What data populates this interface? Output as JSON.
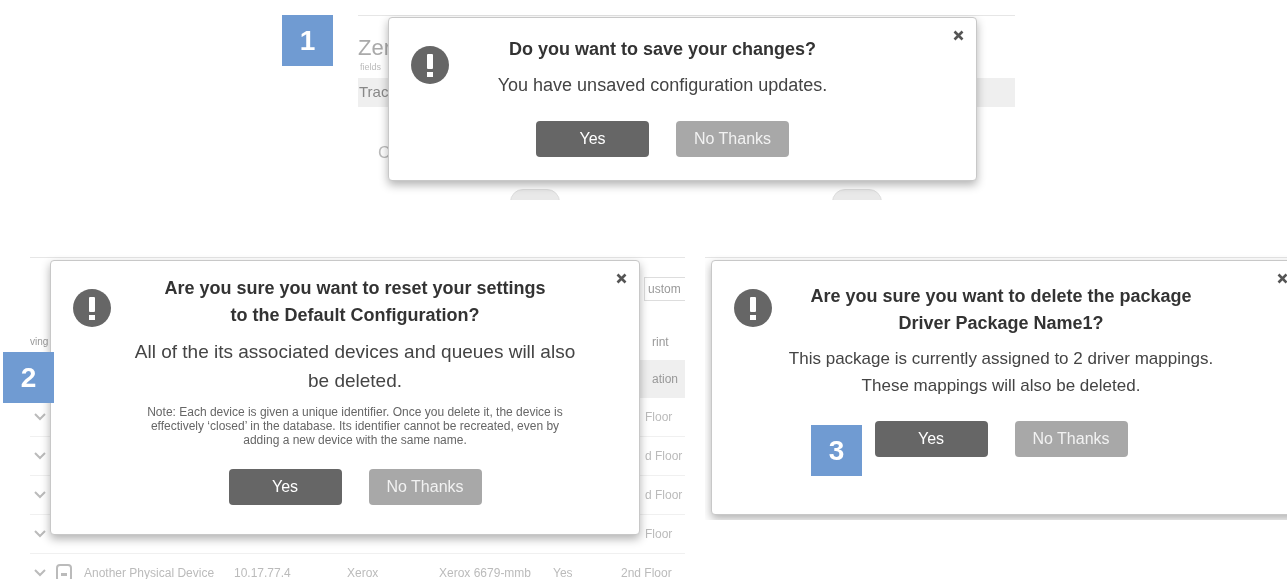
{
  "examples": [
    {
      "number": "1",
      "background": {
        "kind": "settings",
        "heading": "Zer",
        "caption": "fields",
        "bar": "Trac",
        "label": "C",
        "toggles": [
          {
            "on": false
          },
          {
            "on": false
          }
        ]
      },
      "dialog": {
        "title": "Do you want to save your changes?",
        "message": "You have unsaved configuration updates.",
        "buttons": [
          {
            "label": "Yes",
            "kind": "primary"
          },
          {
            "label": "No Thanks",
            "kind": "secondary"
          }
        ]
      }
    },
    {
      "number": "2",
      "background": {
        "kind": "table",
        "left_label": "ving",
        "filter": "ustom",
        "header": "rint",
        "bar": "ation",
        "rows": [
          {
            "kind": "partial",
            "floor": "Floor"
          },
          {
            "kind": "partial",
            "floor": "d Floor"
          },
          {
            "kind": "partial",
            "floor": "d Floor"
          },
          {
            "kind": "partial",
            "floor": "Floor"
          },
          {
            "kind": "full",
            "name": "Another Physical Device",
            "ip": "10.17.77.4",
            "make": "Xerox",
            "model": "Xerox 6679-mmb",
            "active": "Yes",
            "floor": "2nd Floor"
          }
        ]
      },
      "dialog": {
        "title": "Are you sure you want to reset your settings\nto the Default Configuration?",
        "message": "All of the its associated devices and queues will also\nbe deleted.",
        "note": "Note: Each device is given a unique identifier. Once you delete it, the device is\neffectively ‘closed’ in the database. Its identifier cannot be recreated, even by\nadding a new device with the same name.",
        "buttons": [
          {
            "label": "Yes",
            "kind": "primary"
          },
          {
            "label": "No Thanks",
            "kind": "secondary"
          }
        ]
      }
    },
    {
      "number": "3",
      "background": {
        "kind": "blank"
      },
      "dialog": {
        "title": "Are you sure you want to delete the package\nDriver Package Name1?",
        "message": "This package is currently assigned to 2 driver mappings.\nThese mappings will also be deleted.",
        "buttons": [
          {
            "label": "Yes",
            "kind": "primary"
          },
          {
            "label": "No Thanks",
            "kind": "secondary"
          }
        ]
      }
    }
  ]
}
